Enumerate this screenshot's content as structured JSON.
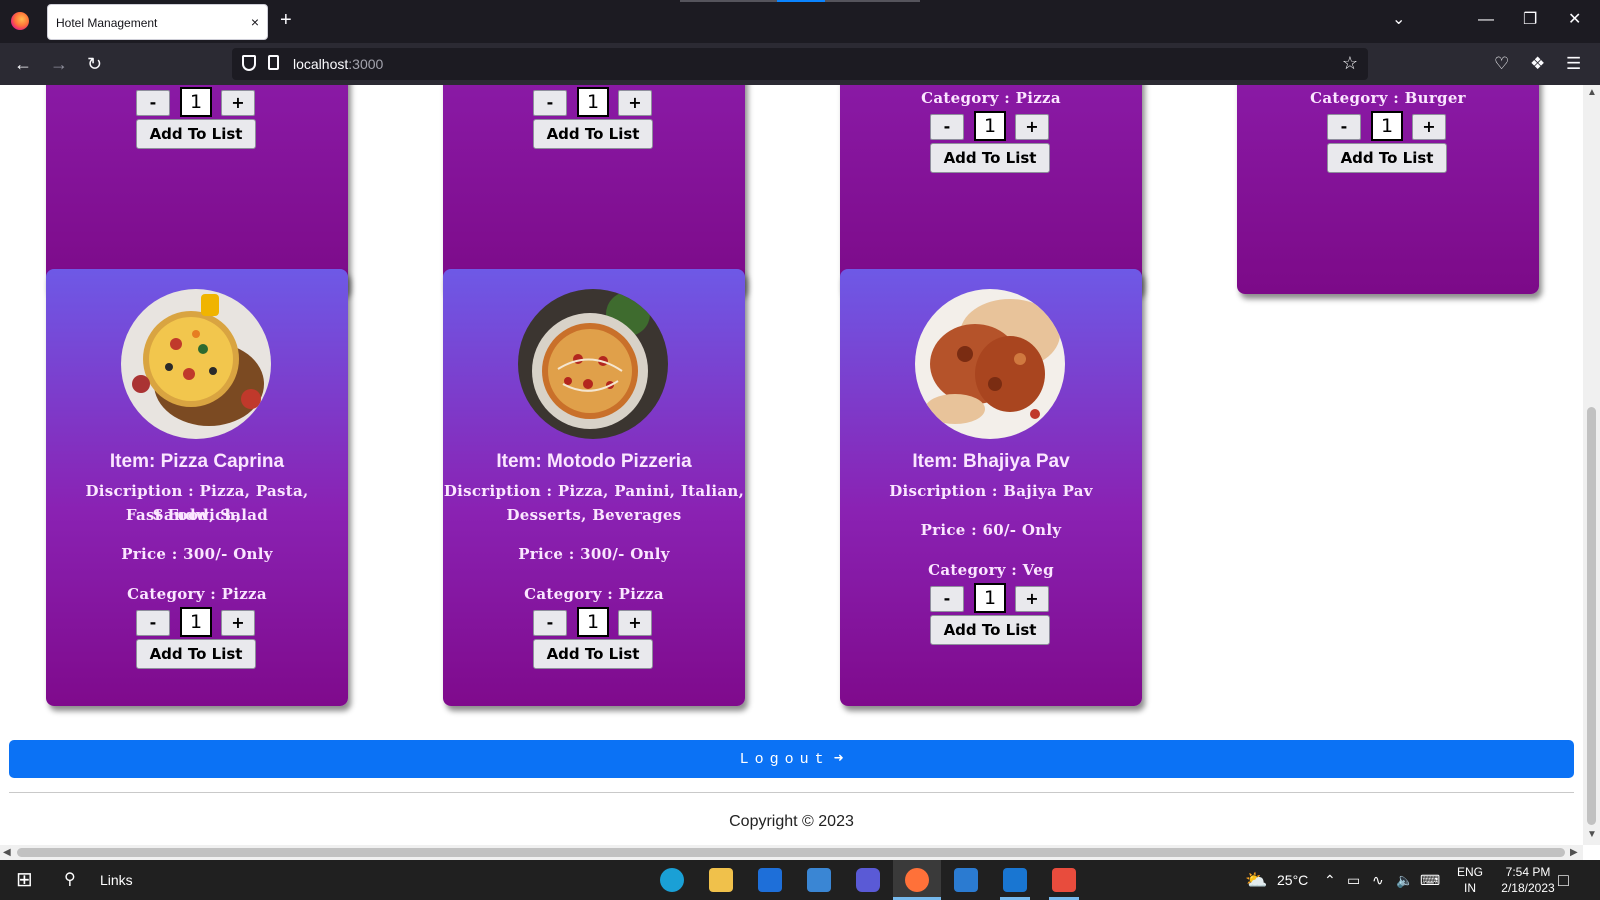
{
  "browser": {
    "tab_title": "Hotel Management",
    "tab_close": "×",
    "new_tab": "+",
    "url_host": "localhost",
    "url_port": ":3000",
    "minimize": "—",
    "restore": "❐",
    "close": "✕",
    "list_tabs": "⌄"
  },
  "cards_top": [
    {
      "category": "",
      "qty": "1",
      "add_label": "Add To List",
      "minus": "-",
      "plus": "+"
    },
    {
      "category": "",
      "qty": "1",
      "add_label": "Add To List",
      "minus": "-",
      "plus": "+"
    },
    {
      "category": "Category : Pizza",
      "qty": "1",
      "add_label": "Add To List",
      "minus": "-",
      "plus": "+"
    },
    {
      "category": "Category : Burger",
      "qty": "1",
      "add_label": "Add To List",
      "minus": "-",
      "plus": "+"
    }
  ],
  "cards": [
    {
      "item": "Item: Pizza Caprina",
      "description_1": "Discription : Pizza, Pasta, Sandwich,",
      "description_2": "Fast Food, Salad",
      "price": "Price : 300/- Only",
      "category": "Category : Pizza",
      "qty": "1",
      "minus": "-",
      "plus": "+",
      "add_label": "Add To List"
    },
    {
      "item": "Item: Motodo Pizzeria",
      "description_1": "Discription : Pizza, Panini, Italian,",
      "description_2": "Desserts, Beverages",
      "price": "Price : 300/- Only",
      "category": "Category : Pizza",
      "qty": "1",
      "minus": "-",
      "plus": "+",
      "add_label": "Add To List"
    },
    {
      "item": "Item: Bhajiya Pav",
      "description_1": "Discription : Bajiya Pav",
      "description_2": "",
      "price": "Price : 60/- Only",
      "category": "Category : Veg",
      "qty": "1",
      "minus": "-",
      "plus": "+",
      "add_label": "Add To List"
    }
  ],
  "logout_label": "Logout",
  "copyright": "Copyright © 2023",
  "taskbar": {
    "search_label": "Links",
    "weather": "25°C",
    "lang_1": "ENG",
    "lang_2": "IN",
    "time": "7:54 PM",
    "date": "2/18/2023"
  },
  "colors": {
    "card_top": "#6e59e6",
    "card_bottom": "#7f0a8c",
    "logout_bg": "#0b72f5"
  }
}
